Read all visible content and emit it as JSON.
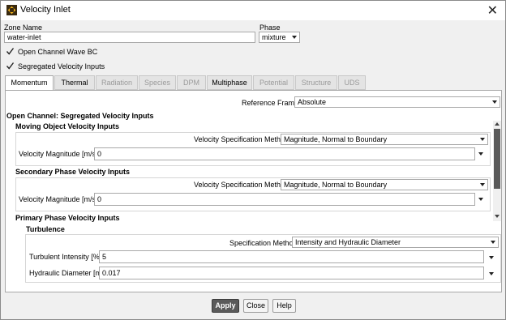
{
  "window": {
    "title": "Velocity Inlet"
  },
  "zone": {
    "label": "Zone Name",
    "value": "water-inlet"
  },
  "phase": {
    "label": "Phase",
    "value": "mixture"
  },
  "checkboxes": {
    "open_channel": {
      "label": "Open Channel Wave BC",
      "checked": true
    },
    "segregated": {
      "label": "Segregated Velocity Inputs",
      "checked": true
    }
  },
  "tabs": [
    {
      "label": "Momentum",
      "state": "selected"
    },
    {
      "label": "Thermal",
      "state": "enabled"
    },
    {
      "label": "Radiation",
      "state": "disabled"
    },
    {
      "label": "Species",
      "state": "disabled"
    },
    {
      "label": "DPM",
      "state": "disabled"
    },
    {
      "label": "Multiphase",
      "state": "enabled"
    },
    {
      "label": "Potential",
      "state": "disabled"
    },
    {
      "label": "Structure",
      "state": "disabled"
    },
    {
      "label": "UDS",
      "state": "disabled"
    }
  ],
  "momentum": {
    "reference_frame": {
      "label": "Reference Frame",
      "value": "Absolute"
    },
    "open_channel_header": "Open Channel: Segregated Velocity Inputs",
    "moving_object": {
      "header": "Moving Object Velocity Inputs",
      "method_label": "Velocity Specification Method",
      "method_value": "Magnitude, Normal to Boundary",
      "magnitude_label": "Velocity Magnitude [m/s]",
      "magnitude_value": "0"
    },
    "secondary_phase": {
      "header": "Secondary Phase Velocity Inputs",
      "method_label": "Velocity Specification Method",
      "method_value": "Magnitude, Normal to Boundary",
      "magnitude_label": "Velocity Magnitude [m/s]",
      "magnitude_value": "0"
    },
    "primary_phase": {
      "header": "Primary Phase Velocity Inputs"
    },
    "turbulence": {
      "header": "Turbulence",
      "method_label": "Specification Method",
      "method_value": "Intensity and Hydraulic Diameter",
      "intensity_label": "Turbulent Intensity [%]",
      "intensity_value": "5",
      "diameter_label": "Hydraulic Diameter [m]",
      "diameter_value": "0.017"
    }
  },
  "buttons": {
    "apply": "Apply",
    "close": "Close",
    "help": "Help"
  }
}
